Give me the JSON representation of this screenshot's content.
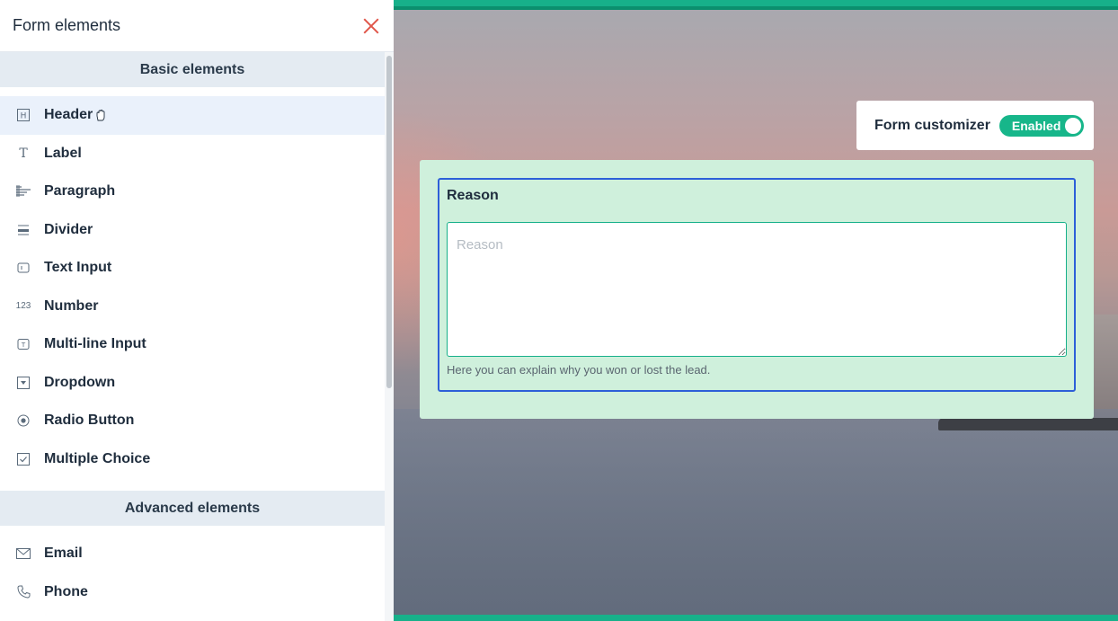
{
  "sidebar": {
    "title": "Form elements",
    "sections": [
      {
        "heading": "Basic elements",
        "items": [
          {
            "label": "Header",
            "icon": "header-icon"
          },
          {
            "label": "Label",
            "icon": "label-icon"
          },
          {
            "label": "Paragraph",
            "icon": "paragraph-icon"
          },
          {
            "label": "Divider",
            "icon": "divider-icon"
          },
          {
            "label": "Text Input",
            "icon": "text-input-icon"
          },
          {
            "label": "Number",
            "icon": "number-icon"
          },
          {
            "label": "Multi-line Input",
            "icon": "multiline-input-icon"
          },
          {
            "label": "Dropdown",
            "icon": "dropdown-icon"
          },
          {
            "label": "Radio Button",
            "icon": "radio-button-icon"
          },
          {
            "label": "Multiple Choice",
            "icon": "checkbox-icon"
          }
        ]
      },
      {
        "heading": "Advanced elements",
        "items": [
          {
            "label": "Email",
            "icon": "email-icon"
          },
          {
            "label": "Phone",
            "icon": "phone-icon"
          }
        ]
      }
    ]
  },
  "customizer": {
    "label": "Form customizer",
    "toggle_text": "Enabled"
  },
  "form": {
    "field_title": "Reason",
    "placeholder": "Reason",
    "help_text": "Here you can explain why you won or lost the lead."
  },
  "colors": {
    "accent": "#17b08a",
    "focus_border": "#2d5fd8",
    "form_bg": "#cff0dc",
    "close": "#e0564a"
  }
}
